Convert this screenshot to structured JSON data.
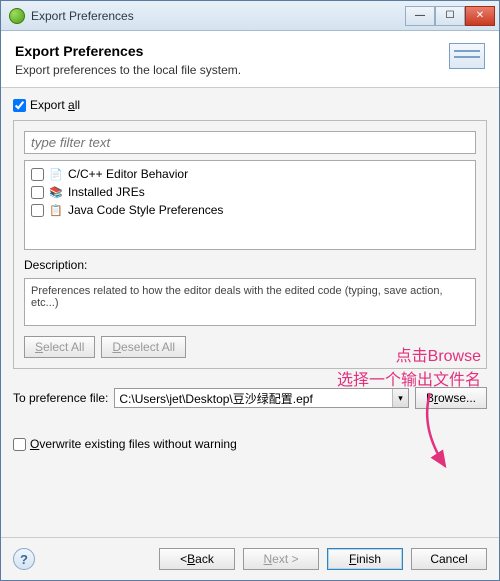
{
  "window": {
    "title": "Export Preferences"
  },
  "header": {
    "title": "Export Preferences",
    "description": "Export preferences to the local file system."
  },
  "export_all": {
    "label_pre": "Export ",
    "label_u": "a",
    "label_post": "ll",
    "checked": true
  },
  "filter": {
    "placeholder": "type filter text"
  },
  "tree": {
    "items": [
      {
        "label": "C/C++ Editor Behavior",
        "icon": "cpp"
      },
      {
        "label": "Installed JREs",
        "icon": "jre"
      },
      {
        "label": "Java Code Style Preferences",
        "icon": "java"
      }
    ]
  },
  "description": {
    "label": "Description:",
    "text": "Preferences related to how the editor deals with the edited code (typing, save action, etc...)"
  },
  "buttons": {
    "select_all_pre": "",
    "select_all_u": "S",
    "select_all_post": "elect All",
    "deselect_all_pre": "",
    "deselect_all_u": "D",
    "deselect_all_post": "eselect All",
    "browse_pre": "B",
    "browse_u": "r",
    "browse_post": "owse..."
  },
  "pref_file": {
    "label": "To preference file:",
    "value": "C:\\Users\\jet\\Desktop\\豆沙绿配置.epf"
  },
  "overwrite": {
    "label_pre": "",
    "label_u": "O",
    "label_post": "verwrite existing files without warning",
    "checked": false
  },
  "annotation": {
    "line1": "点击Browse",
    "line2": "选择一个输出文件名"
  },
  "footer": {
    "back_pre": "< ",
    "back_u": "B",
    "back_post": "ack",
    "next_pre": "",
    "next_u": "N",
    "next_post": "ext >",
    "finish_pre": "",
    "finish_u": "F",
    "finish_post": "inish",
    "cancel": "Cancel"
  }
}
